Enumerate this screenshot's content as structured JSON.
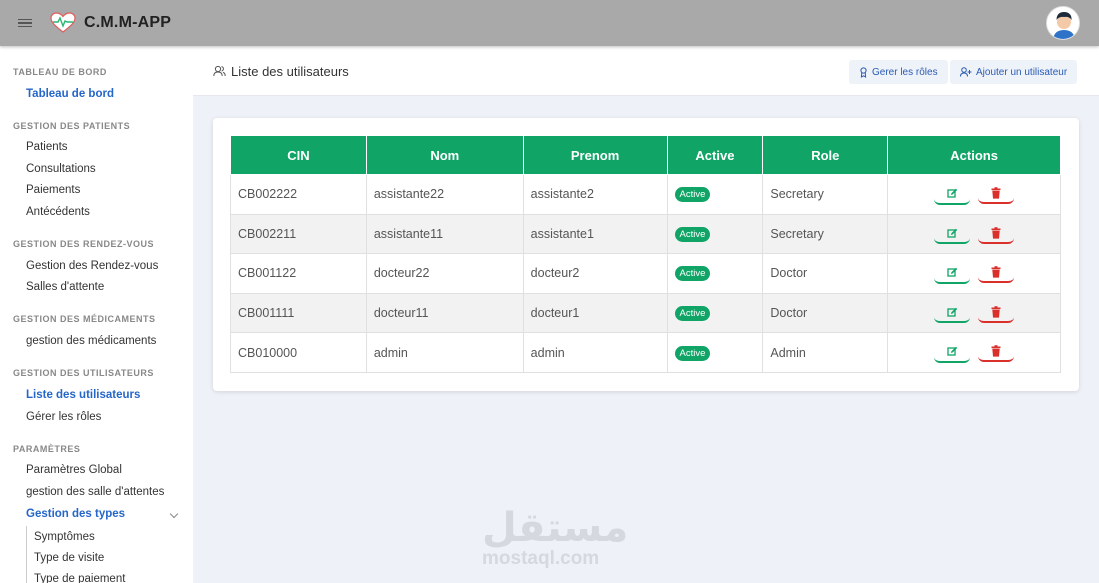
{
  "app": {
    "title": "C.M.M-APP"
  },
  "sidebar": {
    "sections": [
      {
        "title": "TABLEAU DE BORD"
      },
      {
        "title": "GESTION DES PATIENTS"
      },
      {
        "title": "GESTION DES RENDEZ-VOUS"
      },
      {
        "title": "GESTION DES MÉDICAMENTS"
      },
      {
        "title": "GESTION DES UTILISATEURS"
      },
      {
        "title": "PARAMÈTRES"
      }
    ],
    "items": [
      {
        "label": "Tableau de bord",
        "active": true
      },
      {
        "label": "Patients"
      },
      {
        "label": "Consultations"
      },
      {
        "label": "Paiements"
      },
      {
        "label": "Antécédents"
      },
      {
        "label": "Gestion des Rendez-vous"
      },
      {
        "label": "Salles d'attente"
      },
      {
        "label": "gestion des médicaments"
      },
      {
        "label": "Liste des utilisateurs",
        "active": true
      },
      {
        "label": "Gérer les rôles"
      },
      {
        "label": "Paramètres Global"
      },
      {
        "label": "gestion des salle d'attentes"
      },
      {
        "label": "Gestion des types",
        "active": true,
        "expanded": true
      },
      {
        "label": "Symptômes"
      },
      {
        "label": "Type de visite"
      },
      {
        "label": "Type de paiement"
      }
    ]
  },
  "header": {
    "title": "Liste des utilisateurs",
    "buttons": {
      "roles": "Gerer les rôles",
      "add_user": "Ajouter un utilisateur"
    }
  },
  "table": {
    "columns": [
      "CIN",
      "Nom",
      "Prenom",
      "Active",
      "Role",
      "Actions"
    ],
    "rows": [
      {
        "cin": "CB002222",
        "nom": "assistante22",
        "prenom": "assistante2",
        "active": "Active",
        "role": "Secretary"
      },
      {
        "cin": "CB002211",
        "nom": "assistante11",
        "prenom": "assistante1",
        "active": "Active",
        "role": "Secretary"
      },
      {
        "cin": "CB001122",
        "nom": "docteur22",
        "prenom": "docteur2",
        "active": "Active",
        "role": "Doctor"
      },
      {
        "cin": "CB001111",
        "nom": "docteur11",
        "prenom": "docteur1",
        "active": "Active",
        "role": "Doctor"
      },
      {
        "cin": "CB010000",
        "nom": "admin",
        "prenom": "admin",
        "active": "Active",
        "role": "Admin"
      }
    ]
  },
  "watermark": {
    "arabic": "مستقل",
    "latin": "mostaql.com"
  },
  "colors": {
    "primary_green": "#10a566",
    "danger_red": "#d9302c",
    "link_blue": "#2566c9",
    "topbar": "#a9a9a9"
  },
  "icons": [
    "hamburger-icon",
    "heart-pulse-logo-icon",
    "avatar",
    "users-icon",
    "role-icon",
    "add-user-icon",
    "edit-icon",
    "trash-icon",
    "chevron-down-icon"
  ]
}
